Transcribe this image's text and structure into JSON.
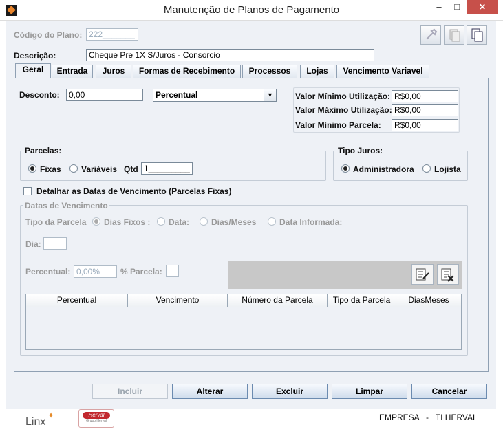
{
  "window": {
    "title": "Manutenção de Planos de Pagamento",
    "minimize": "–",
    "maximize": "□",
    "close": "✕"
  },
  "header": {
    "codigo_label": "Código do Plano:",
    "codigo_value": "222_______",
    "descricao_label": "Descrição:",
    "descricao_value": "Cheque Pre 1X S/Juros - Consorcio"
  },
  "tabs": [
    "Geral",
    "Entrada",
    "Juros",
    "Formas de Recebimento",
    "Processos",
    "Lojas",
    "Vencimento Variavel"
  ],
  "geral": {
    "desconto_label": "Desconto:",
    "desconto_value": "0,00",
    "desconto_tipo": "Percentual",
    "valor_min_util_label": "Valor Mínimo Utilização:",
    "valor_min_util_value": "R$0,00",
    "valor_max_util_label": "Valor Máximo Utilização:",
    "valor_max_util_value": "R$0,00",
    "valor_min_parcela_label": "Valor Mínimo Parcela:",
    "valor_min_parcela_value": "R$0,00",
    "parcelas_title": "Parcelas:",
    "fixas": "Fixas",
    "variaveis": "Variáveis",
    "qtd_label": "Qtd",
    "qtd_value": "1_________",
    "tipo_juros_title": "Tipo Juros:",
    "administradora": "Administradora",
    "lojista": "Lojista",
    "detalhar_label": "Detalhar as Datas de Vencimento (Parcelas Fixas)",
    "datas_title": "Datas de Vencimento",
    "tipo_parcela_label": "Tipo da Parcela",
    "dias_fixos": "Dias Fixos :",
    "data": "Data:",
    "dias_meses": "Dias/Meses",
    "data_informada": "Data Informada:",
    "dia_label": "Dia:",
    "percentual_label": "Percentual:",
    "percentual_value": "0,00%",
    "percent_sign": "%",
    "parcela_label": "Parcela:",
    "columns": [
      "Percentual",
      "Vencimento",
      "Número da Parcela",
      "Tipo da Parcela",
      "DiasMeses"
    ]
  },
  "buttons": {
    "incluir": "Incluir",
    "alterar": "Alterar",
    "excluir": "Excluir",
    "limpar": "Limpar",
    "cancelar": "Cancelar"
  },
  "footer": {
    "linx": "Linx",
    "herval": "Herval",
    "herval_sub": "Grupo Herval",
    "empresa": "EMPRESA   -   TI HERVAL"
  }
}
